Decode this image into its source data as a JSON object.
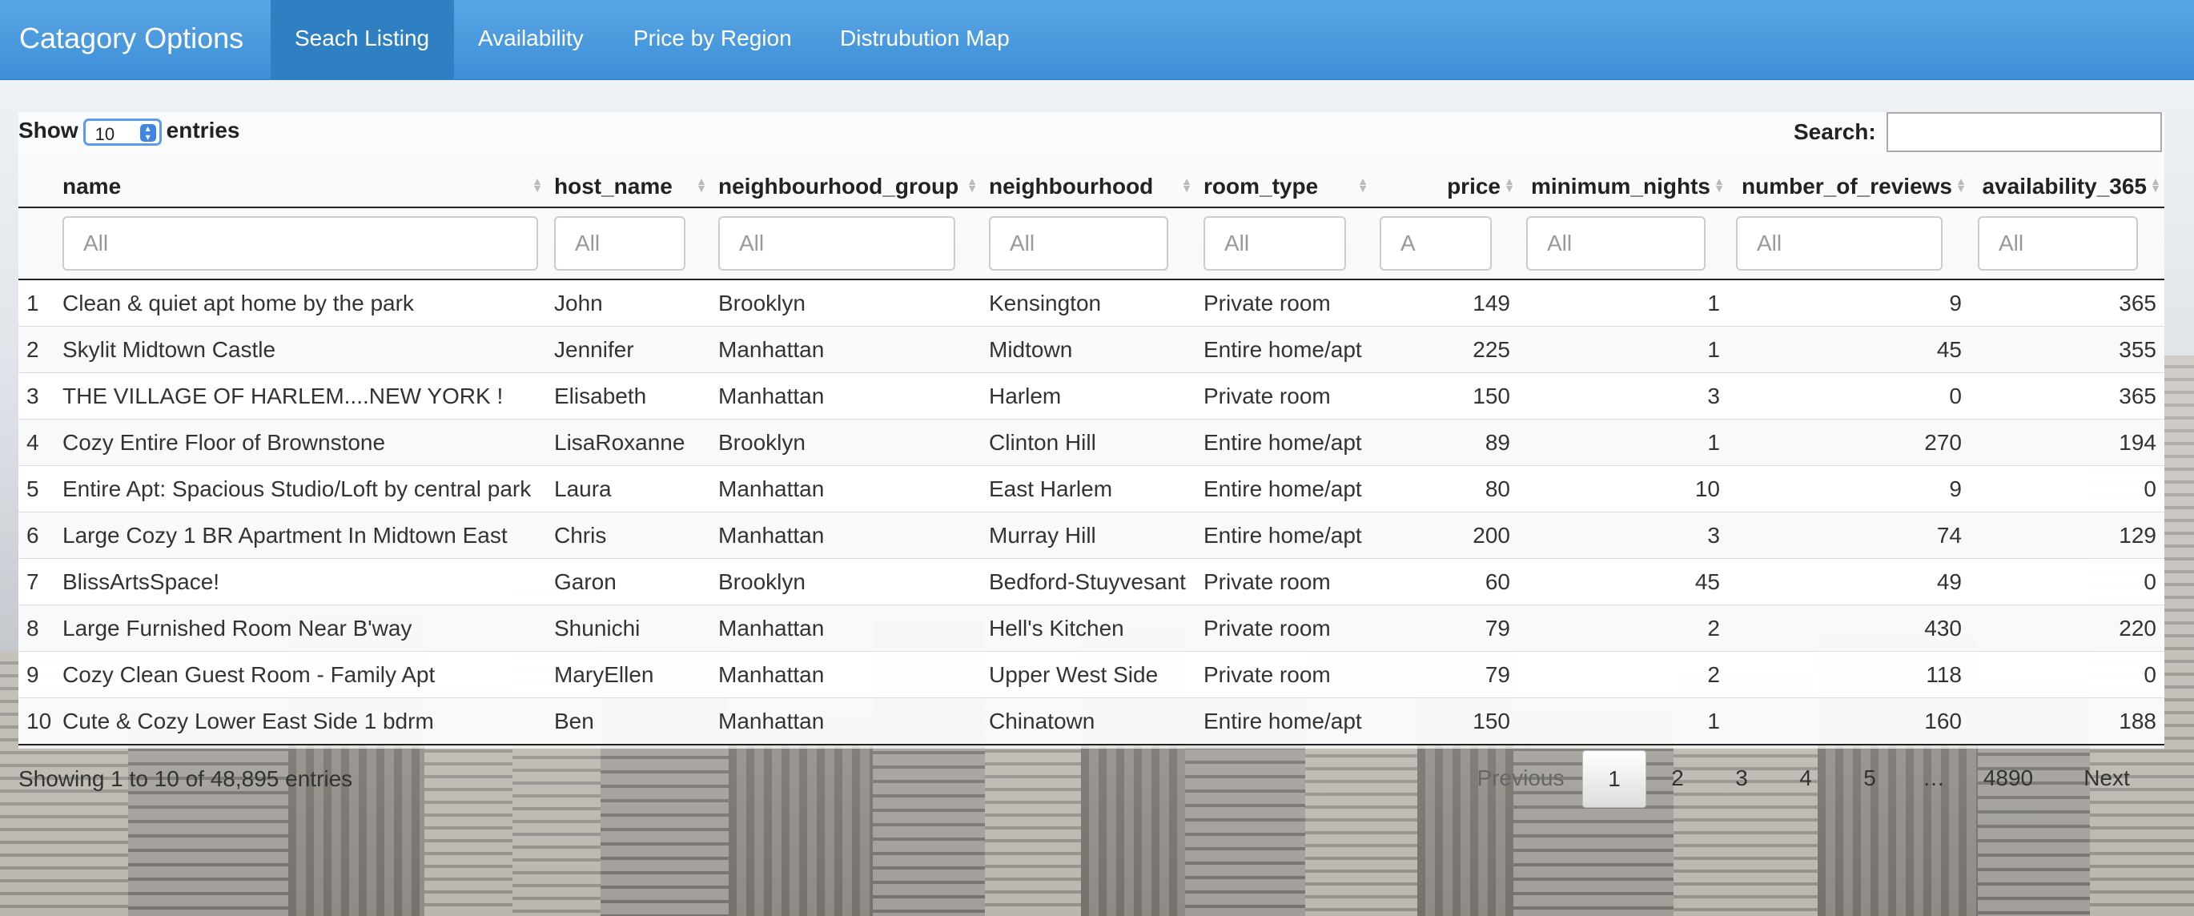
{
  "navbar": {
    "brand": "Catagory Options",
    "tabs": [
      {
        "label": "Seach Listing",
        "active": true
      },
      {
        "label": "Availability"
      },
      {
        "label": "Price by Region"
      },
      {
        "label": "Distrubution Map"
      }
    ]
  },
  "length_menu": {
    "prefix": "Show",
    "selected": "10",
    "suffix": "entries"
  },
  "search": {
    "label": "Search:",
    "value": ""
  },
  "table": {
    "columns": [
      "",
      "name",
      "host_name",
      "neighbourhood_group",
      "neighbourhood",
      "room_type",
      "price",
      "minimum_nights",
      "number_of_reviews",
      "availability_365"
    ],
    "filter_placeholders": [
      "All",
      "All",
      "All",
      "All",
      "All",
      "A",
      "All",
      "All",
      "All"
    ],
    "rows": [
      [
        "1",
        "Clean & quiet apt home by the park",
        "John",
        "Brooklyn",
        "Kensington",
        "Private room",
        "149",
        "1",
        "9",
        "365"
      ],
      [
        "2",
        "Skylit Midtown Castle",
        "Jennifer",
        "Manhattan",
        "Midtown",
        "Entire home/apt",
        "225",
        "1",
        "45",
        "355"
      ],
      [
        "3",
        "THE VILLAGE OF HARLEM....NEW YORK !",
        "Elisabeth",
        "Manhattan",
        "Harlem",
        "Private room",
        "150",
        "3",
        "0",
        "365"
      ],
      [
        "4",
        "Cozy Entire Floor of Brownstone",
        "LisaRoxanne",
        "Brooklyn",
        "Clinton Hill",
        "Entire home/apt",
        "89",
        "1",
        "270",
        "194"
      ],
      [
        "5",
        "Entire Apt: Spacious Studio/Loft by central park",
        "Laura",
        "Manhattan",
        "East Harlem",
        "Entire home/apt",
        "80",
        "10",
        "9",
        "0"
      ],
      [
        "6",
        "Large Cozy 1 BR Apartment In Midtown East",
        "Chris",
        "Manhattan",
        "Murray Hill",
        "Entire home/apt",
        "200",
        "3",
        "74",
        "129"
      ],
      [
        "7",
        "BlissArtsSpace!",
        "Garon",
        "Brooklyn",
        "Bedford-Stuyvesant",
        "Private room",
        "60",
        "45",
        "49",
        "0"
      ],
      [
        "8",
        "Large Furnished Room Near B'way",
        "Shunichi",
        "Manhattan",
        "Hell's Kitchen",
        "Private room",
        "79",
        "2",
        "430",
        "220"
      ],
      [
        "9",
        "Cozy Clean Guest Room - Family Apt",
        "MaryEllen",
        "Manhattan",
        "Upper West Side",
        "Private room",
        "79",
        "2",
        "118",
        "0"
      ],
      [
        "10",
        "Cute & Cozy Lower East Side 1 bdrm",
        "Ben",
        "Manhattan",
        "Chinatown",
        "Entire home/apt",
        "150",
        "1",
        "160",
        "188"
      ]
    ]
  },
  "info": "Showing 1 to 10 of 48,895 entries",
  "pagination": {
    "previous": "Previous",
    "pages": [
      "1",
      "2",
      "3",
      "4",
      "5",
      "…",
      "4890"
    ],
    "current": "1",
    "next": "Next"
  }
}
